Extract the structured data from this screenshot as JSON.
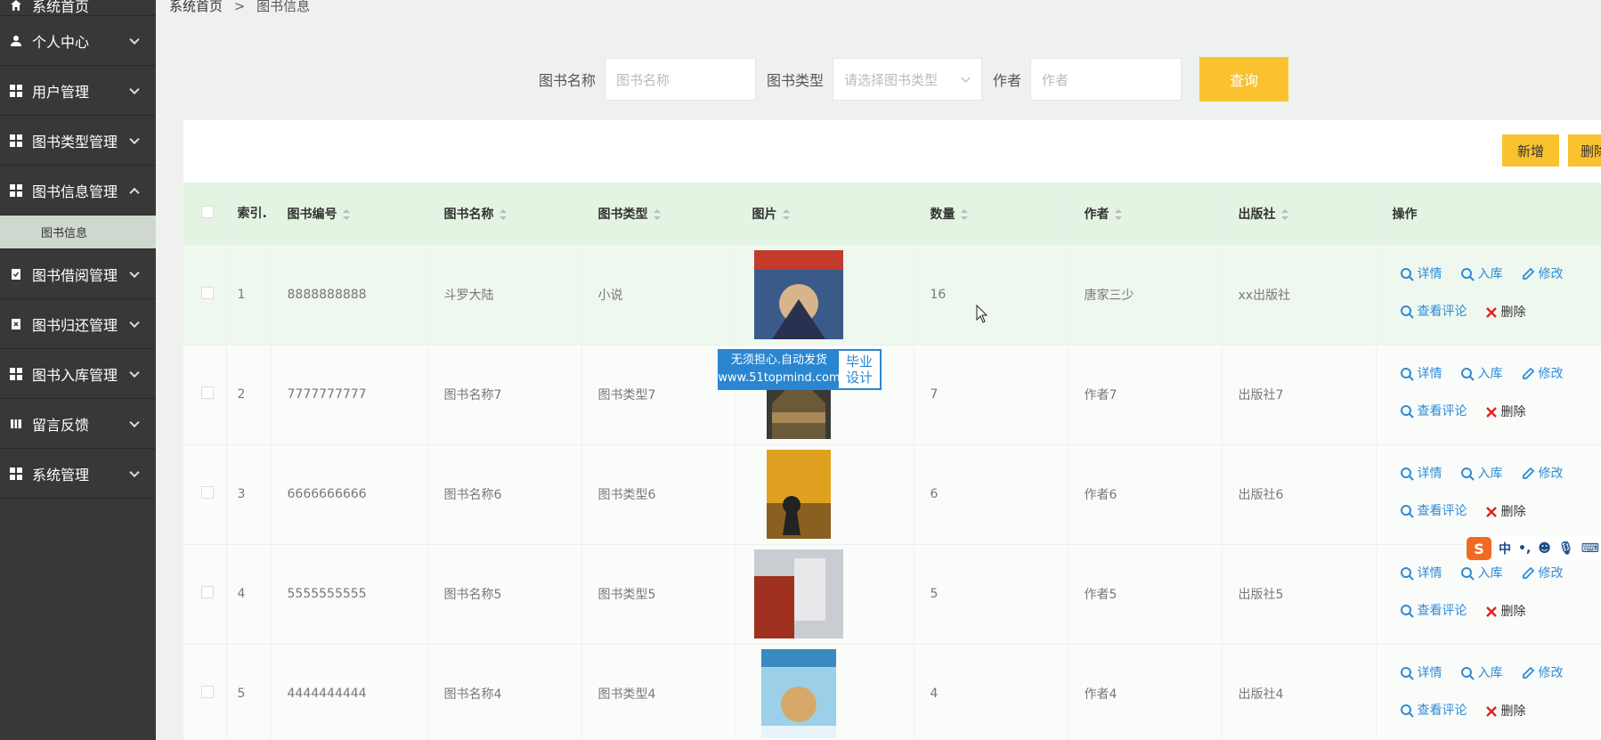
{
  "sidebar": {
    "items": [
      {
        "label": "系统首页",
        "icon": "home-icon"
      },
      {
        "label": "个人中心",
        "icon": "user-icon"
      },
      {
        "label": "用户管理",
        "icon": "grid-icon"
      },
      {
        "label": "图书类型管理",
        "icon": "grid-icon"
      },
      {
        "label": "图书信息管理",
        "icon": "grid-icon"
      },
      {
        "label": "图书借阅管理",
        "icon": "clipboard-check-icon"
      },
      {
        "label": "图书归还管理",
        "icon": "clipboard-x-icon"
      },
      {
        "label": "图书入库管理",
        "icon": "grid-icon"
      },
      {
        "label": "留言反馈",
        "icon": "book-icon"
      },
      {
        "label": "系统管理",
        "icon": "grid-icon"
      }
    ],
    "submenu": {
      "label": "图书信息"
    }
  },
  "breadcrumb": {
    "home": "系统首页",
    "separator": ">",
    "current": "图书信息"
  },
  "search": {
    "name_label": "图书名称",
    "name_placeholder": "图书名称",
    "type_label": "图书类型",
    "type_placeholder": "请选择图书类型",
    "author_label": "作者",
    "author_placeholder": "作者",
    "query_button": "查询"
  },
  "toolbar": {
    "add": "新增",
    "delete": "删除"
  },
  "table": {
    "headers": {
      "index": "索引.",
      "code": "图书编号",
      "name": "图书名称",
      "type": "图书类型",
      "image": "图片",
      "quantity": "数量",
      "author": "作者",
      "publisher": "出版社",
      "actions": "操作"
    },
    "rows": [
      {
        "index": "1",
        "code": "8888888888",
        "name": "斗罗大陆",
        "type": "小说",
        "quantity": "16",
        "author": "唐家三少",
        "publisher": "xx出版社"
      },
      {
        "index": "2",
        "code": "7777777777",
        "name": "图书名称7",
        "type": "图书类型7",
        "quantity": "7",
        "author": "作者7",
        "publisher": "出版社7"
      },
      {
        "index": "3",
        "code": "6666666666",
        "name": "图书名称6",
        "type": "图书类型6",
        "quantity": "6",
        "author": "作者6",
        "publisher": "出版社6"
      },
      {
        "index": "4",
        "code": "5555555555",
        "name": "图书名称5",
        "type": "图书类型5",
        "quantity": "5",
        "author": "作者5",
        "publisher": "出版社5"
      },
      {
        "index": "5",
        "code": "4444444444",
        "name": "图书名称4",
        "type": "图书类型4",
        "quantity": "4",
        "author": "作者4",
        "publisher": "出版社4"
      }
    ],
    "actions": {
      "detail": "详情",
      "stock_in": "入库",
      "edit": "修改",
      "view_comments": "查看评论",
      "delete": "删除"
    }
  },
  "watermark": {
    "line1": "无须担心.自动发货",
    "line2": "www.51topmind.com",
    "tag1": "毕业",
    "tag2": "设计"
  },
  "ime": {
    "s": "S",
    "lang": "中"
  },
  "colors": {
    "sidebar": "#383838",
    "accent": "#f9c22e",
    "header_row": "#e3f4e3",
    "link": "#2e8bd8",
    "danger": "#e02020"
  }
}
